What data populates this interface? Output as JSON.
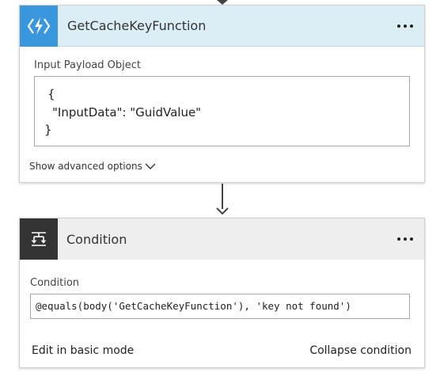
{
  "function_card": {
    "title": "GetCacheKeyFunction",
    "icon": "azure-function-icon",
    "accent_color": "#3a96dd",
    "header_bg": "#dbeef6",
    "payload_label": "Input Payload Object",
    "payload_lines": [
      "{",
      "\"InputData\": \"GuidValue\"",
      "}"
    ],
    "advanced_options_label": "Show advanced options"
  },
  "condition_card": {
    "title": "Condition",
    "icon": "condition-icon",
    "icon_bg": "#333333",
    "header_bg": "#eeeeee",
    "condition_label": "Condition",
    "expression": "@equals(body('GetCacheKeyFunction'), 'key not found')",
    "edit_basic_label": "Edit in basic mode",
    "collapse_label": "Collapse condition"
  }
}
